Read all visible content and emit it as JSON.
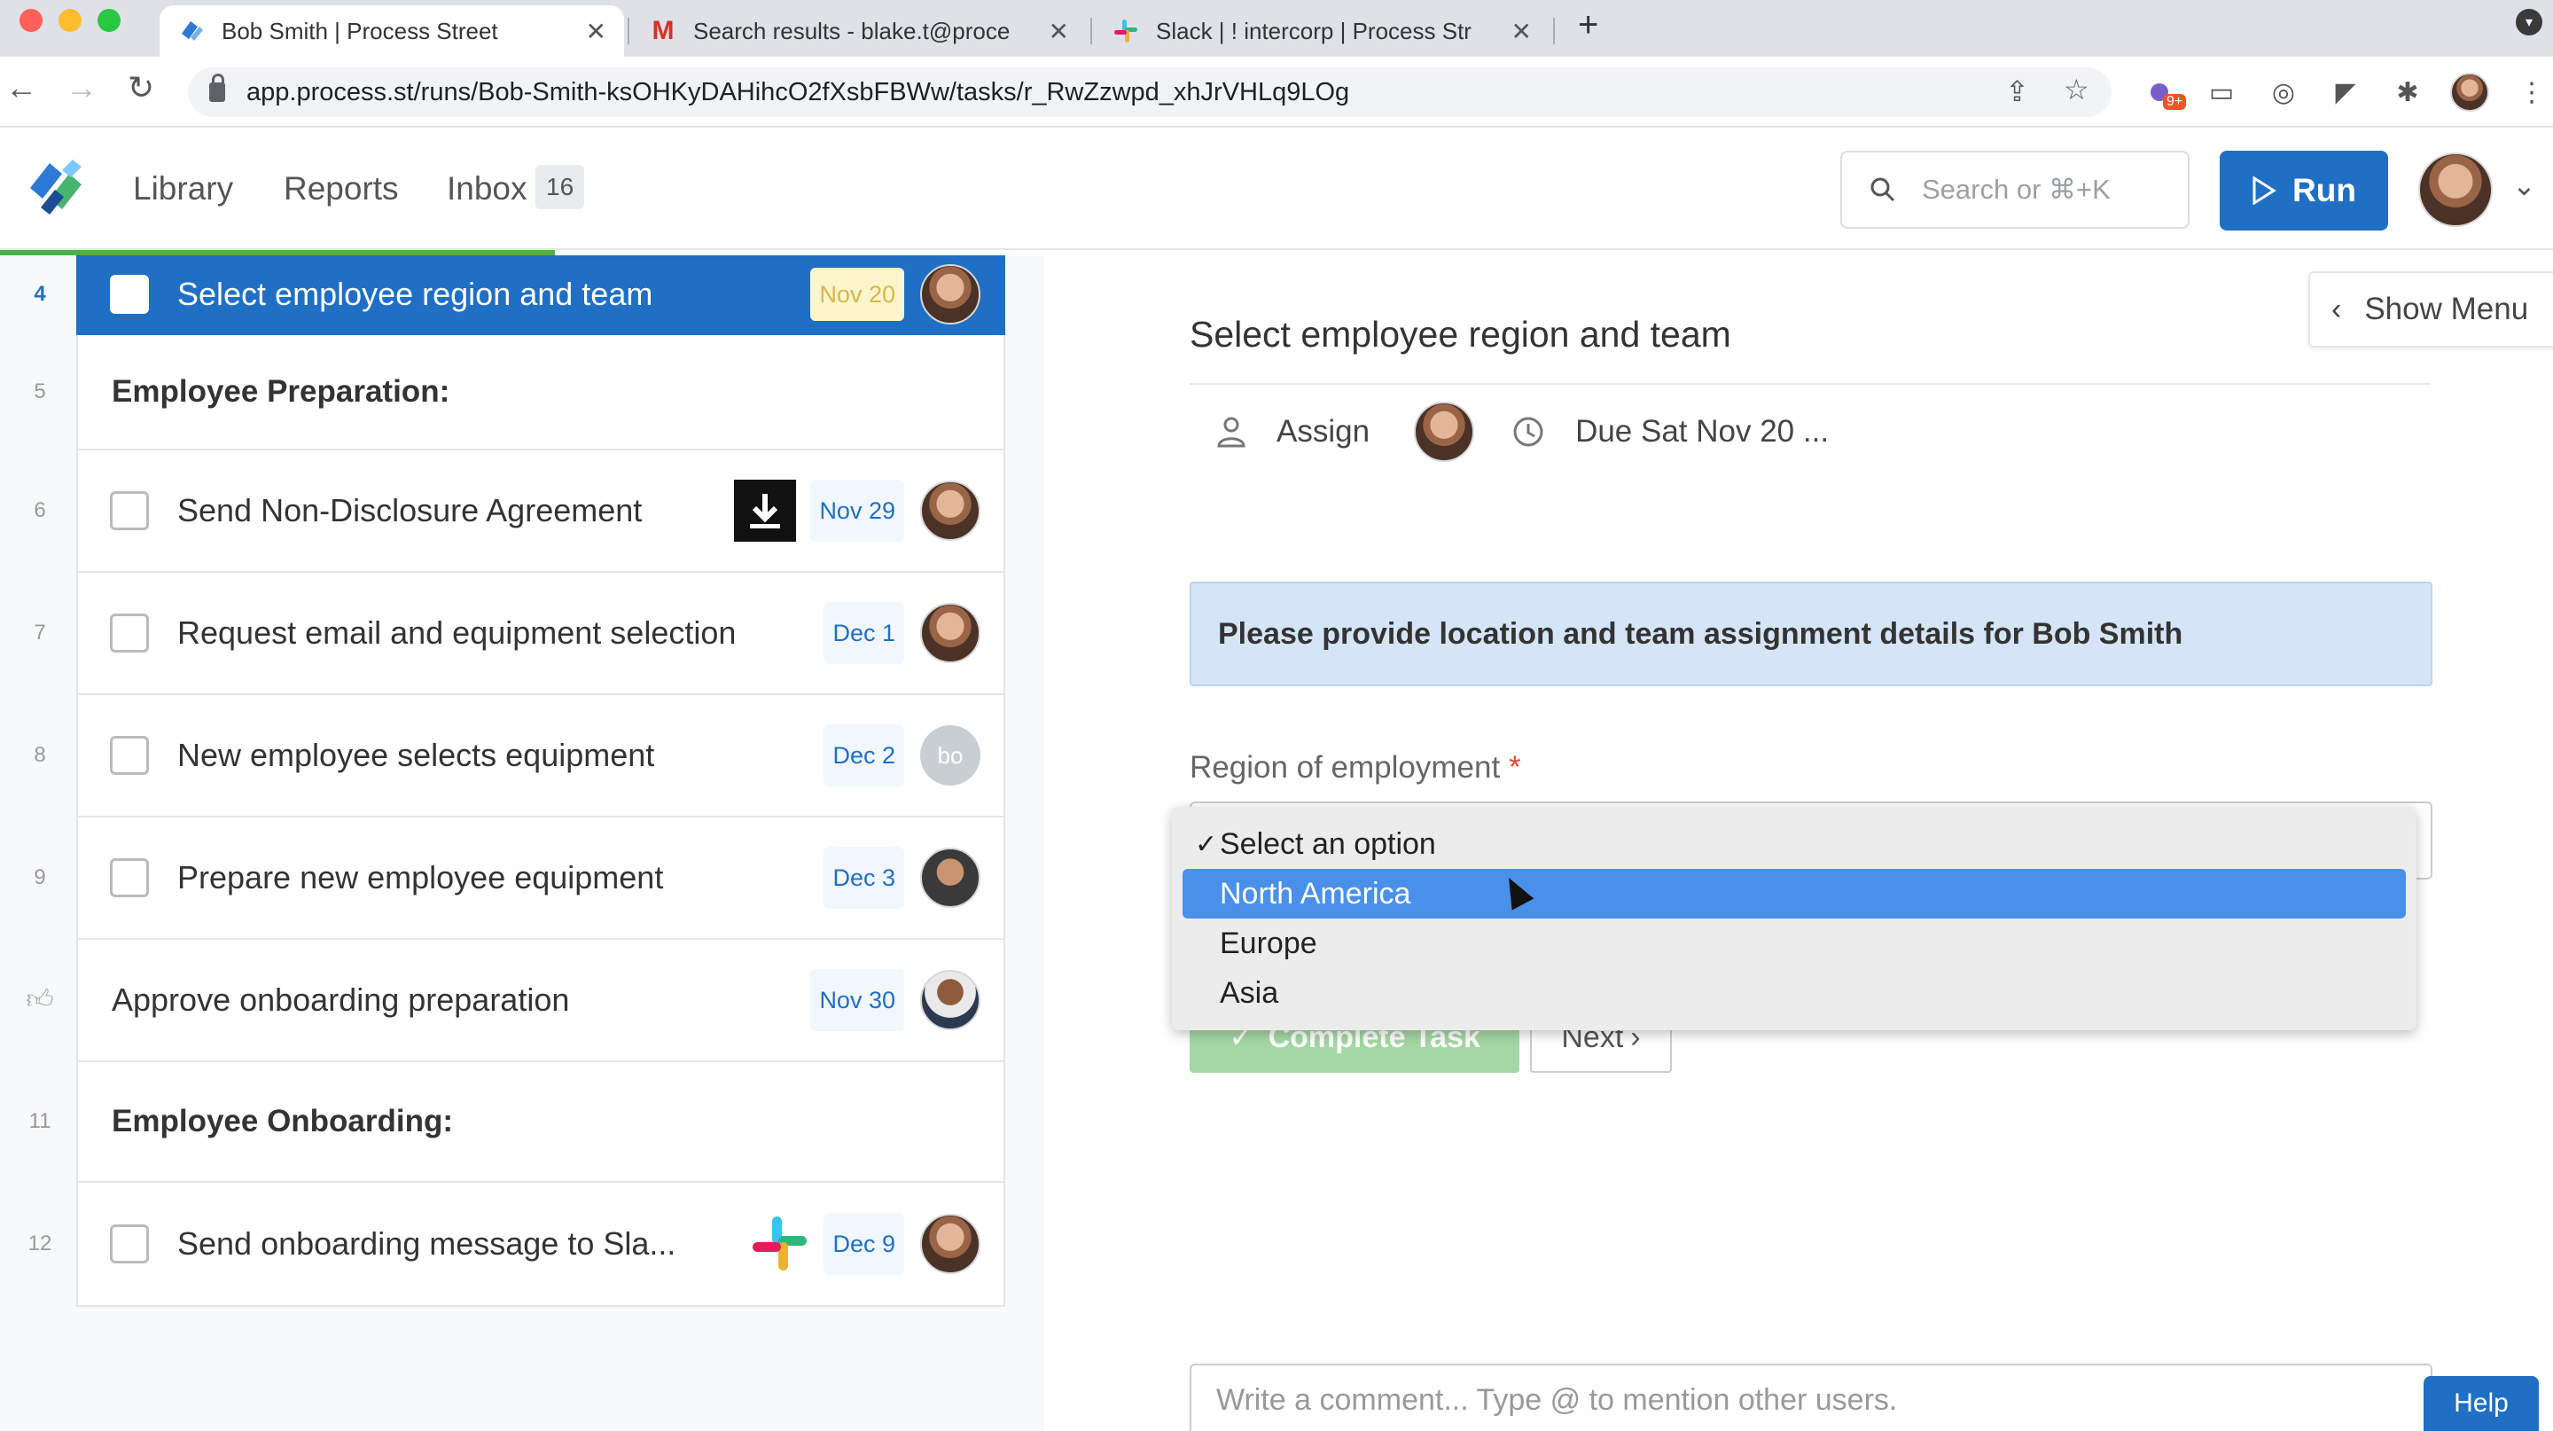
{
  "browser": {
    "tabs": [
      {
        "title": "Bob Smith | Process Street",
        "icon": "process-street-icon"
      },
      {
        "title": "Search results - blake.t@proce",
        "icon": "gmail-icon"
      },
      {
        "title": "Slack | ! intercorp | Process Str",
        "icon": "slack-icon"
      }
    ],
    "url": "app.process.st/runs/Bob-Smith-ksOHKyDAHihcO2fXsbFBWw/tasks/r_RwZzwpd_xhJrVHLq9LOg",
    "extension_badge": "9+"
  },
  "header": {
    "nav": {
      "library": "Library",
      "reports": "Reports",
      "inbox": "Inbox",
      "inbox_count": "16"
    },
    "search_placeholder": "Search or ⌘+K",
    "run_label": "Run"
  },
  "tasks": [
    {
      "num": "4",
      "type": "task",
      "label": "Select employee region and team",
      "due": "Nov 20",
      "active": true
    },
    {
      "num": "5",
      "type": "heading",
      "label": "Employee Preparation:"
    },
    {
      "num": "6",
      "type": "task",
      "label": "Send Non-Disclosure Agreement",
      "due": "Nov 29"
    },
    {
      "num": "7",
      "type": "task",
      "label": "Request email and equipment selection",
      "due": "Dec 1"
    },
    {
      "num": "8",
      "type": "task",
      "label": "New employee selects equipment",
      "due": "Dec 2",
      "avatar_text": "bo"
    },
    {
      "num": "9",
      "type": "task",
      "label": "Prepare new employee equipment",
      "due": "Dec 3"
    },
    {
      "num": "",
      "type": "approval",
      "label": "Approve onboarding preparation",
      "due": "Nov 30"
    },
    {
      "num": "11",
      "type": "heading",
      "label": "Employee Onboarding:"
    },
    {
      "num": "12",
      "type": "task",
      "label": "Send onboarding message to Sla...",
      "due": "Dec 9"
    }
  ],
  "detail": {
    "show_menu": "Show Menu",
    "title": "Select employee region and team",
    "assign_label": "Assign",
    "due_label": "Due Sat Nov 20 ...",
    "info_text": "Please provide location and team assignment details for Bob Smith",
    "field_label": "Region of employment",
    "required_mark": "*",
    "options": [
      "Select an option",
      "North America",
      "Europe",
      "Asia"
    ],
    "selected_option": "Select an option",
    "highlighted_option": "North America",
    "complete_label": "Complete Task",
    "next_label": "Next",
    "comment_placeholder": "Write a comment... Type @ to mention other users.",
    "help_label": "Help"
  },
  "colors": {
    "primary": "#1f6fc5",
    "progress": "#4caf50",
    "info_bg": "#d5e5f7",
    "option_highlight": "#4a90ea",
    "complete_green": "#5cb85c",
    "due_yellow_bg": "#fff5cc"
  }
}
